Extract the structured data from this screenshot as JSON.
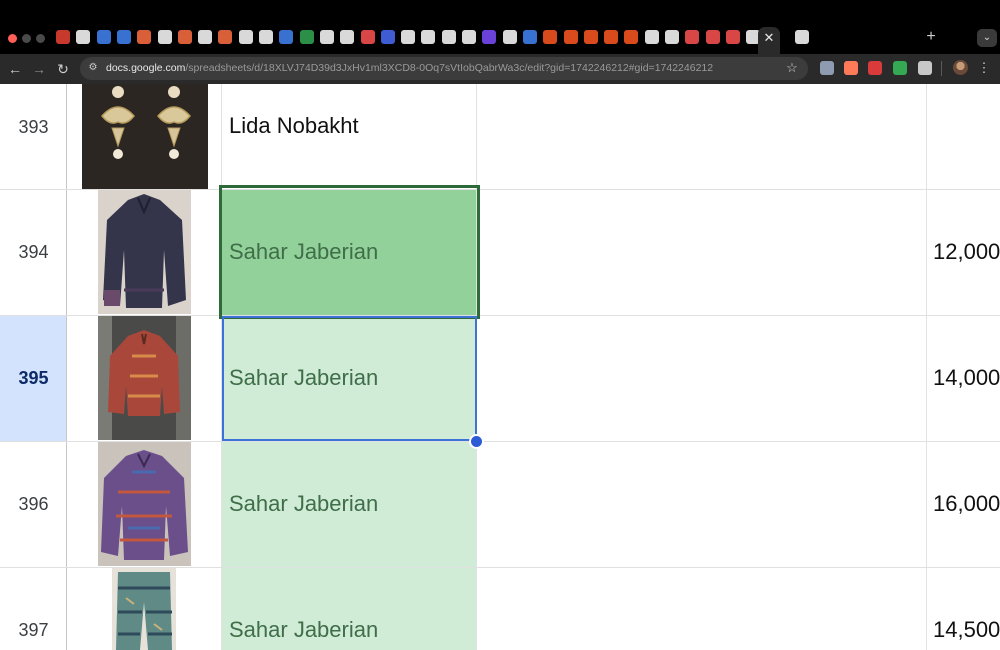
{
  "browser": {
    "url_host": "docs.google.com",
    "url_path": "/spreadsheets/d/18XLVJ74D39d3JxHv1ml3XCD8-0Oq7sVtIobQabrWa3c/edit?gid=1742246212#gid=1742246212",
    "icons": {
      "back": "arrow-left-icon",
      "forward": "arrow-right-icon",
      "reload": "reload-icon",
      "site_info": "tune-icon",
      "bookmark": "star-icon",
      "new_tab": "plus-icon",
      "tab_search": "chevron-down-icon",
      "menu": "kebab-icon",
      "close_tab": "close-icon"
    },
    "tab_colors": [
      "#ea4335",
      "#ffffff",
      "#4285f4",
      "#4285f4",
      "#ff7043",
      "#ffffff",
      "#ff7043",
      "#ffffff",
      "#ff7043",
      "#ffffff",
      "#ffffff",
      "#4285f4",
      "#34a853",
      "#ffffff",
      "#ffffff",
      "#ff5252",
      "#4a6cf7",
      "#ffffff",
      "#ffffff",
      "#ffffff",
      "#ffffff",
      "#7c4dff",
      "#ffffff",
      "#4285f4",
      "#ff5722",
      "#ff5722",
      "#ff5722",
      "#ff5722",
      "#ff5722",
      "#ffffff",
      "#ffffff",
      "#ff5252",
      "#ff5252",
      "#ff5252",
      "#ffffff",
      "#ffffff"
    ]
  },
  "sheet": {
    "selection_color": "#2e6b3a",
    "range_color": "#3b73d9",
    "rows": [
      {
        "row_number": "393",
        "name": "Lida Nobakht",
        "amount": "",
        "image": "earrings-photo"
      },
      {
        "row_number": "394",
        "name": "Sahar Jaberian",
        "amount": "12,000",
        "image": "dark-jacket-photo"
      },
      {
        "row_number": "395",
        "name": "Sahar Jaberian",
        "amount": "14,000",
        "image": "red-jacket-photo"
      },
      {
        "row_number": "396",
        "name": "Sahar Jaberian",
        "amount": "16,000",
        "image": "purple-shirt-photo"
      },
      {
        "row_number": "397",
        "name": "Sahar Jaberian",
        "amount": "14,500",
        "image": "patterned-pants-photo"
      }
    ]
  }
}
